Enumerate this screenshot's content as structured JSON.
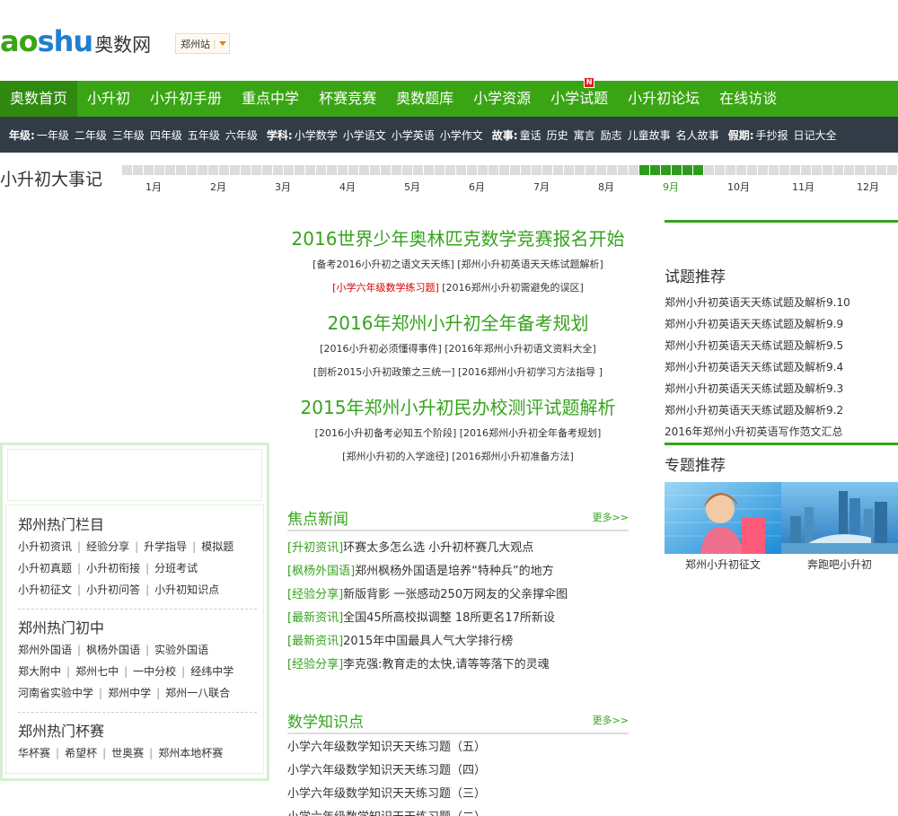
{
  "header": {
    "logo_en_1": "ao",
    "logo_en_2": "shu",
    "logo_cn": "奥数网",
    "site": "郑州站"
  },
  "nav": {
    "items": [
      "奥数首页",
      "小升初",
      "小升初手册",
      "重点中学",
      "杯赛竞赛",
      "奥数题库",
      "小学资源",
      "小学试题",
      "小升初论坛",
      "在线访谈"
    ],
    "badge": "N"
  },
  "subnav": {
    "grade_label": "年级:",
    "grades": [
      "一年级",
      "二年级",
      "三年级",
      "四年级",
      "五年级",
      "六年级"
    ],
    "subject_label": "学科:",
    "subjects": [
      "小学数学",
      "小学语文",
      "小学英语",
      "小学作文"
    ],
    "story_label": "故事:",
    "stories": [
      "童话",
      "历史",
      "寓言",
      "励志",
      "儿童故事",
      "名人故事"
    ],
    "holiday_label": "假期:",
    "holidays": [
      "手抄报",
      "日记大全"
    ]
  },
  "timeline": {
    "title": "小升初大事记",
    "months": [
      "1月",
      "2月",
      "3月",
      "4月",
      "5月",
      "6月",
      "7月",
      "8月",
      "9月",
      "10月",
      "11月",
      "12月"
    ],
    "current_month": "9月"
  },
  "headlines": [
    {
      "title": "2016世界少年奥林匹克数学竞赛报名开始",
      "line1": "[备考2016小升初之语文天天练] [郑州小升初英语天天练试题解析]",
      "line2_red": "[小学六年级数学练习题]",
      "line2": " [2016郑州小升初需避免的误区]"
    },
    {
      "title": "2016年郑州小升初全年备考规划",
      "line1": "[2016小升初必须懂得事件] [2016年郑州小升初语文资料大全]",
      "line2": "[剖析2015小升初政策之三统一] [2016郑州小升初学习方法指导 ]"
    },
    {
      "title": "2015年郑州小升初民办校测评试题解析",
      "line1": "[2016小升初备考必知五个阶段] [2016郑州小升初全年备考规划]",
      "line2": "[郑州小升初的入学途径] [2016郑州小升初准备方法]"
    }
  ],
  "focus_news": {
    "title": "焦点新闻",
    "more": "更多>>",
    "items": [
      {
        "tag": "[升初资讯]",
        "text": "环赛太多怎么选 小升初杯赛几大观点"
      },
      {
        "tag": "[枫杨外国语]",
        "text": "郑州枫杨外国语是培养“特种兵”的地方"
      },
      {
        "tag": "[经验分享]",
        "text": "新版背影 一张感动250万网友的父亲撑伞图"
      },
      {
        "tag": "[最新资讯]",
        "text": "全国45所高校拟调整 18所更名17所新设"
      },
      {
        "tag": "[最新资讯]",
        "text": "2015年中国最具人气大学排行榜"
      },
      {
        "tag": "[经验分享]",
        "text": "李克强:教育走的太快,请等等落下的灵魂"
      }
    ]
  },
  "math_points": {
    "title": "数学知识点",
    "more": "更多>>",
    "items": [
      "小学六年级数学知识天天练习题（五）",
      "小学六年级数学知识天天练习题（四）",
      "小学六年级数学知识天天练习题（三）",
      "小学六年级数学知识天天练习题（二）"
    ]
  },
  "left": {
    "groups": [
      {
        "title": "郑州热门栏目",
        "rows": [
          [
            "小升初资讯",
            "经验分享",
            "升学指导",
            "模拟题"
          ],
          [
            "小升初真题",
            "小升初衔接",
            "分班考试"
          ],
          [
            "小升初征文",
            "小升初问答",
            "小升初知识点"
          ]
        ]
      },
      {
        "title": "郑州热门初中",
        "rows": [
          [
            "郑州外国语",
            "枫杨外国语",
            "实验外国语"
          ],
          [
            "郑大附中",
            "郑州七中",
            "一中分校",
            "经纬中学"
          ],
          [
            "河南省实验中学",
            "郑州中学",
            "郑州一八联合"
          ]
        ]
      },
      {
        "title": "郑州热门杯赛",
        "rows": [
          [
            "华杯赛",
            "希望杯",
            "世奥赛",
            "郑州本地杯赛"
          ]
        ]
      }
    ]
  },
  "right": {
    "tests_title": "试题推荐",
    "tests": [
      "郑州小升初英语天天练试题及解析9.10",
      "郑州小升初英语天天练试题及解析9.9",
      "郑州小升初英语天天练试题及解析9.5",
      "郑州小升初英语天天练试题及解析9.4",
      "郑州小升初英语天天练试题及解析9.3",
      "郑州小升初英语天天练试题及解析9.2",
      "2016年郑州小升初英语写作范文汇总"
    ],
    "topics_title": "专题推荐",
    "topics": [
      "郑州小升初征文",
      "奔跑吧小升初"
    ]
  }
}
